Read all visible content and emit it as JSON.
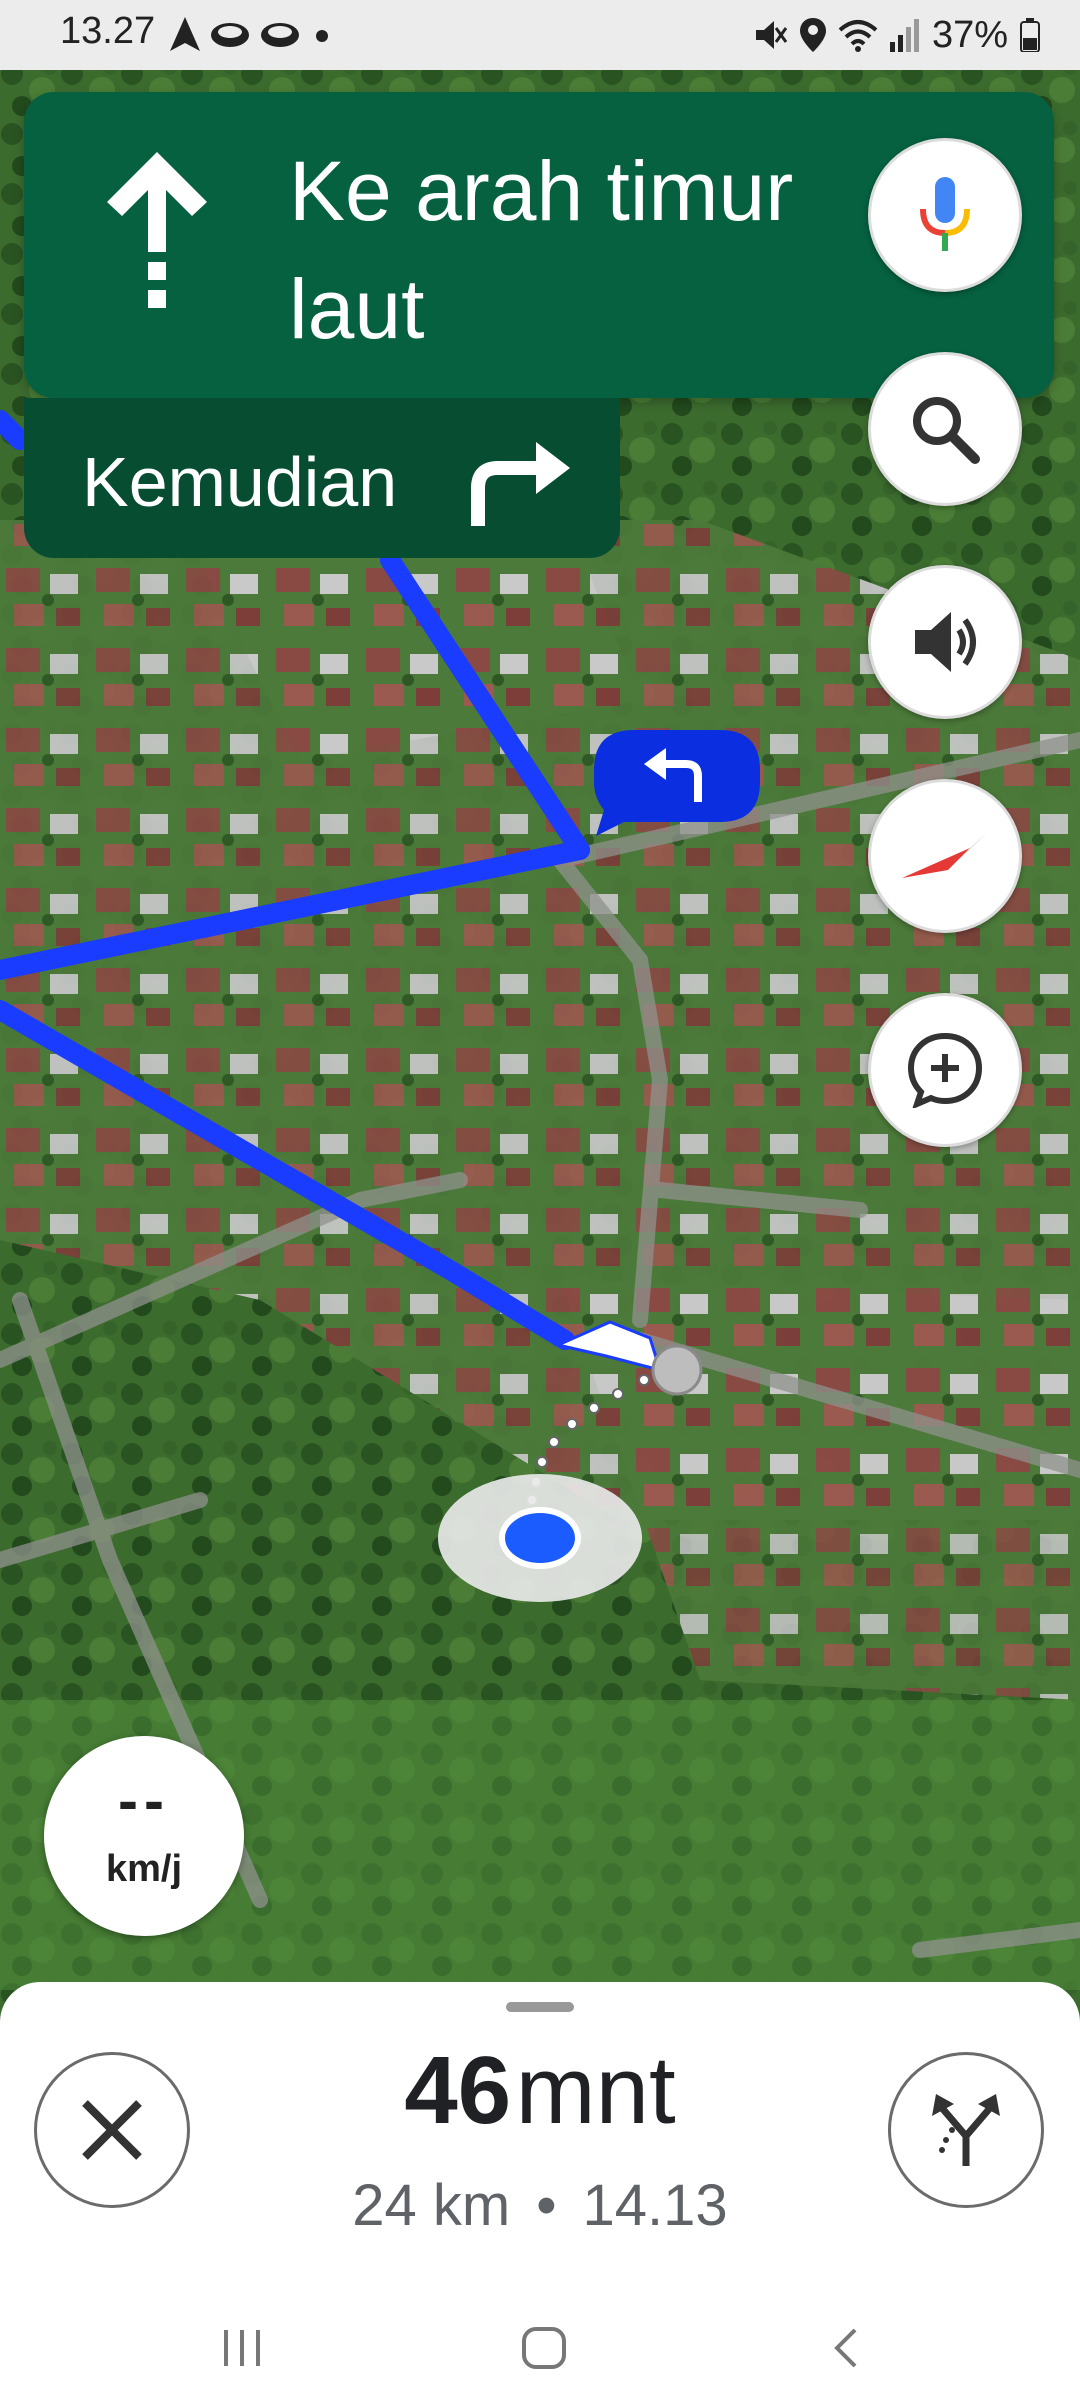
{
  "status_bar": {
    "time": "13.27",
    "battery": "37%",
    "left_icons": [
      "navigation-arrow-icon",
      "cloud-icon",
      "cloud-icon",
      "dot-icon"
    ],
    "right_icons": [
      "mute-icon",
      "location-icon",
      "wifi-icon",
      "signal-icon",
      "battery-icon"
    ]
  },
  "navigation": {
    "instruction": "Ke arah timur laut",
    "maneuver_icon": "arrow-up-icon",
    "then_label": "Kemudian",
    "then_icon": "turn-right-icon"
  },
  "map_controls": [
    {
      "name": "voice-search-button",
      "icon": "microphone-icon"
    },
    {
      "name": "search-button",
      "icon": "search-icon"
    },
    {
      "name": "sound-button",
      "icon": "speaker-icon"
    },
    {
      "name": "compass-button",
      "icon": "compass-icon"
    },
    {
      "name": "add-report-button",
      "icon": "report-add-icon"
    }
  ],
  "route_callout_icon": "turn-left-icon",
  "speed": {
    "value": "--",
    "unit": "km/j"
  },
  "trip": {
    "duration_number": "46",
    "duration_unit": "mnt",
    "distance": "24 km",
    "separator": "•",
    "arrival_time": "14.13"
  },
  "colors": {
    "banner_primary": "#05613f",
    "banner_secondary": "#064d32",
    "route": "#1a47ff",
    "location_dot": "#1a5cff"
  },
  "system_nav": [
    "recent-apps-icon",
    "home-icon",
    "back-icon"
  ]
}
